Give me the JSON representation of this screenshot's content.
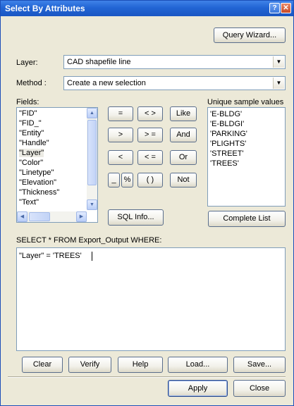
{
  "window": {
    "title": "Select By Attributes",
    "help_glyph": "?",
    "close_glyph": "✕"
  },
  "buttons": {
    "query_wizard": "Query Wizard...",
    "sql_info": "SQL Info...",
    "complete_list": "Complete List",
    "clear": "Clear",
    "verify": "Verify",
    "help": "Help",
    "load": "Load...",
    "save": "Save...",
    "apply": "Apply",
    "close": "Close"
  },
  "layer": {
    "label": "Layer:",
    "value": "CAD shapefile line"
  },
  "method": {
    "label": "Method :",
    "value": "Create a new selection"
  },
  "fields": {
    "label": "Fields:",
    "items": [
      "\"FID\"",
      "\"FID_\"",
      "\"Entity\"",
      "\"Handle\"",
      "\"Layer\"",
      "\"Color\"",
      "\"Linetype\"",
      "\"Elevation\"",
      "\"Thickness\"",
      "\"Text\""
    ],
    "selected": "\"Layer\""
  },
  "operators": {
    "eq": "=",
    "ne": "< >",
    "like": "Like",
    "gt": ">",
    "ge": "> =",
    "and": "And",
    "lt": "<",
    "le": "< =",
    "or": "Or",
    "underscore": "_",
    "percent": "%",
    "parens": "( )",
    "not": "Not"
  },
  "unique_values": {
    "label": "Unique sample values",
    "items": [
      "'E-BLDG'",
      "'E-BLDGI'",
      "'PARKING'",
      "'PLIGHTS'",
      "'STREET'",
      "'TREES'"
    ]
  },
  "query": {
    "header": "SELECT * FROM Export_Output WHERE:",
    "text": "\"Layer\" = 'TREES'"
  },
  "icons": {
    "combo_arrow": "▼",
    "scroll_up": "▲",
    "scroll_down": "▼",
    "scroll_left": "◀",
    "scroll_right": "▶"
  },
  "colors": {
    "titlebar": "#2265d4",
    "dialog_bg": "#ece9d8",
    "field_border": "#7f9db9"
  }
}
